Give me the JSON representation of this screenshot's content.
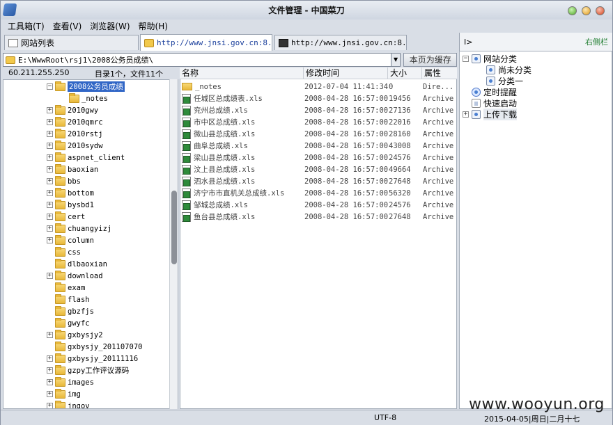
{
  "window": {
    "title": "文件管理 - 中国菜刀"
  },
  "menu": [
    {
      "label": "工具箱(T)"
    },
    {
      "label": "查看(V)"
    },
    {
      "label": "浏览器(W)"
    },
    {
      "label": "帮助(H)"
    }
  ],
  "tabs": [
    {
      "label": "网站列表"
    },
    {
      "label": "http://www.jnsi.gov.cn:8..."
    },
    {
      "label": "http://www.jnsi.gov.cn:8..."
    }
  ],
  "right_panel": {
    "toggle": "I>",
    "label": "右侧栏"
  },
  "address": {
    "path": "E:\\WwwRoot\\rsj1\\2008公务员成绩\\",
    "cache_button": "本页为缓存"
  },
  "info": {
    "ip": "60.211.255.250",
    "summary": "目录1个，文件11个"
  },
  "tree": [
    {
      "label": "2008公务员成绩",
      "expander": "−",
      "indent": 1,
      "selected": true
    },
    {
      "label": "_notes",
      "expander": "",
      "indent": 2
    },
    {
      "label": "2010gwy",
      "expander": "+",
      "indent": 1
    },
    {
      "label": "2010qmrc",
      "expander": "+",
      "indent": 1
    },
    {
      "label": "2010rstj",
      "expander": "+",
      "indent": 1
    },
    {
      "label": "2010sydw",
      "expander": "+",
      "indent": 1
    },
    {
      "label": "aspnet_client",
      "expander": "+",
      "indent": 1
    },
    {
      "label": "baoxian",
      "expander": "+",
      "indent": 1
    },
    {
      "label": "bbs",
      "expander": "+",
      "indent": 1
    },
    {
      "label": "bottom",
      "expander": "+",
      "indent": 1
    },
    {
      "label": "bysbd1",
      "expander": "+",
      "indent": 1
    },
    {
      "label": "cert",
      "expander": "+",
      "indent": 1
    },
    {
      "label": "chuangyizj",
      "expander": "+",
      "indent": 1
    },
    {
      "label": "column",
      "expander": "+",
      "indent": 1
    },
    {
      "label": "css",
      "expander": "",
      "indent": 1
    },
    {
      "label": "dlbaoxian",
      "expander": "",
      "indent": 1
    },
    {
      "label": "download",
      "expander": "+",
      "indent": 1
    },
    {
      "label": "exam",
      "expander": "",
      "indent": 1
    },
    {
      "label": "flash",
      "expander": "",
      "indent": 1
    },
    {
      "label": "gbzfjs",
      "expander": "",
      "indent": 1
    },
    {
      "label": "gwyfc",
      "expander": "",
      "indent": 1
    },
    {
      "label": "gxbysjy2",
      "expander": "+",
      "indent": 1
    },
    {
      "label": "gxbysjy_201107070",
      "expander": "",
      "indent": 1
    },
    {
      "label": "gxbysjy_20111116",
      "expander": "+",
      "indent": 1
    },
    {
      "label": "gzpy工作评议源码",
      "expander": "+",
      "indent": 1
    },
    {
      "label": "images",
      "expander": "+",
      "indent": 1
    },
    {
      "label": "img",
      "expander": "+",
      "indent": 1
    },
    {
      "label": "jngov",
      "expander": "+",
      "indent": 1
    }
  ],
  "columns": {
    "name": "名称",
    "modified": "修改时间",
    "size": "大小",
    "attr": "属性"
  },
  "files": [
    {
      "name": "_notes",
      "modified": "2012-07-04 11:41:34",
      "size": "0",
      "attr": "Dire...",
      "type": "folder"
    },
    {
      "name": "任城区总成绩表.xls",
      "modified": "2008-04-28 16:57:00",
      "size": "19456",
      "attr": "Archive",
      "type": "xls"
    },
    {
      "name": "兖州总成绩.xls",
      "modified": "2008-04-28 16:57:00",
      "size": "27136",
      "attr": "Archive",
      "type": "xls"
    },
    {
      "name": "市中区总成绩.xls",
      "modified": "2008-04-28 16:57:00",
      "size": "22016",
      "attr": "Archive",
      "type": "xls"
    },
    {
      "name": "微山县总成绩.xls",
      "modified": "2008-04-28 16:57:00",
      "size": "28160",
      "attr": "Archive",
      "type": "xls"
    },
    {
      "name": "曲阜总成绩.xls",
      "modified": "2008-04-28 16:57:00",
      "size": "43008",
      "attr": "Archive",
      "type": "xls"
    },
    {
      "name": "梁山县总成绩.xls",
      "modified": "2008-04-28 16:57:00",
      "size": "24576",
      "attr": "Archive",
      "type": "xls"
    },
    {
      "name": "汶上县总成绩.xls",
      "modified": "2008-04-28 16:57:00",
      "size": "49664",
      "attr": "Archive",
      "type": "xls"
    },
    {
      "name": "泗水县总成绩.xls",
      "modified": "2008-04-28 16:57:00",
      "size": "27648",
      "attr": "Archive",
      "type": "xls"
    },
    {
      "name": "济宁市市直机关总成绩.xls",
      "modified": "2008-04-28 16:57:00",
      "size": "56320",
      "attr": "Archive",
      "type": "xls"
    },
    {
      "name": "邹城总成绩.xls",
      "modified": "2008-04-28 16:57:00",
      "size": "24576",
      "attr": "Archive",
      "type": "xls"
    },
    {
      "name": "鱼台县总成绩.xls",
      "modified": "2008-04-28 16:57:00",
      "size": "27648",
      "attr": "Archive",
      "type": "xls"
    }
  ],
  "right_tree": [
    {
      "label": "网站分类",
      "expander": "−",
      "indent": 0,
      "icon": "folder-tree-icon"
    },
    {
      "label": "尚未分类",
      "expander": "",
      "indent": 1,
      "icon": "category-icon"
    },
    {
      "label": "分类一",
      "expander": "",
      "indent": 1,
      "icon": "category-icon"
    },
    {
      "label": "定时提醒",
      "expander": "",
      "indent": 0,
      "icon": "clock-icon"
    },
    {
      "label": "快速启动",
      "expander": "",
      "indent": 0,
      "icon": "document-icon"
    },
    {
      "label": "上传下载",
      "expander": "+",
      "indent": 0,
      "icon": "transfer-icon"
    }
  ],
  "status": {
    "encoding": "UTF-8",
    "date": "2015-04-05|周日|二月十七"
  },
  "watermark": "www.wooyun.org"
}
